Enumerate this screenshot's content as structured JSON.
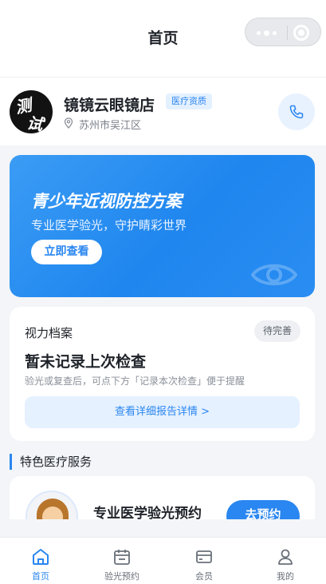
{
  "navbar": {
    "title": "首页"
  },
  "store": {
    "logo_text": [
      "测",
      "试"
    ],
    "name": "镜镜云眼镜店",
    "badge": "医疗资质",
    "location": "苏州市吴江区"
  },
  "banner": {
    "title": "青少年近视防控方案",
    "subtitle": "专业医学验光，守护睛彩世界",
    "button": "立即查看"
  },
  "vision_record": {
    "label": "视力档案",
    "status": "待完善",
    "headline": "暂未记录上次检查",
    "description": "验光或复查后，可点下方「记录本次检查」便于提醒",
    "button": "查看详细报告详情 >"
  },
  "section": {
    "title": "特色医疗服务"
  },
  "service": {
    "title": "专业医学验光预约",
    "button": "去预约"
  },
  "tabbar": {
    "tabs": [
      {
        "label": "首页",
        "icon": "home-icon",
        "active": true
      },
      {
        "label": "验光预约",
        "icon": "calendar-icon",
        "active": false
      },
      {
        "label": "会员",
        "icon": "card-icon",
        "active": false
      },
      {
        "label": "我的",
        "icon": "user-icon",
        "active": false
      }
    ]
  },
  "colors": {
    "accent": "#2a86f0",
    "background": "#f3f5f8"
  }
}
